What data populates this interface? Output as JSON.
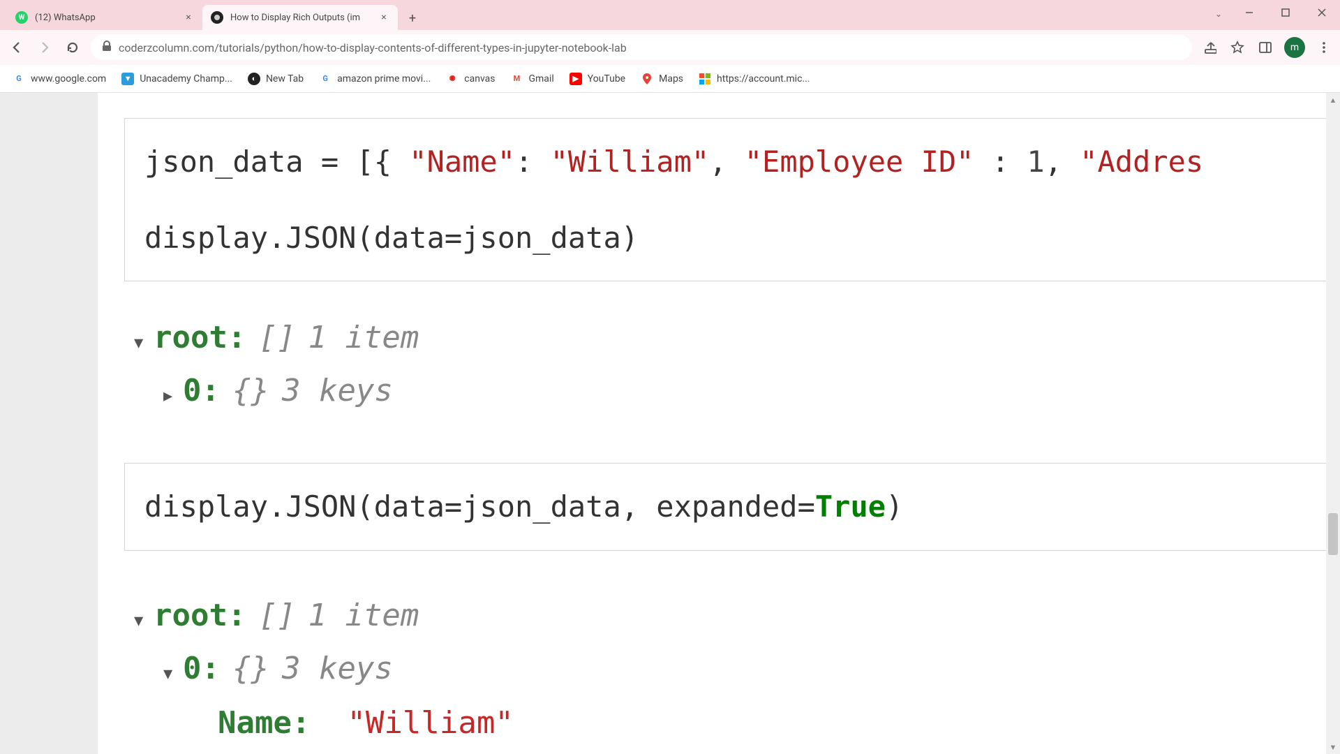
{
  "tabs": [
    {
      "title": "(12) WhatsApp"
    },
    {
      "title": "How to Display Rich Outputs (im"
    }
  ],
  "url": "coderzcolumn.com/tutorials/python/how-to-display-contents-of-different-types-in-jupyter-notebook-lab",
  "profile_letter": "m",
  "bookmarks": [
    {
      "label": "www.google.com"
    },
    {
      "label": "Unacademy Champ..."
    },
    {
      "label": "New Tab"
    },
    {
      "label": "amazon prime movi..."
    },
    {
      "label": "canvas"
    },
    {
      "label": "Gmail"
    },
    {
      "label": "YouTube"
    },
    {
      "label": "Maps"
    },
    {
      "label": "https://account.mic..."
    }
  ],
  "code1": {
    "var": "json_data",
    "key_name": "\"Name\"",
    "val_name": "\"William\"",
    "key_emp": "\"Employee ID\"",
    "val_emp": "1",
    "key_addr_partial": "\"Addres",
    "line2": "display.JSON(data=json_data)"
  },
  "output1": {
    "root_label": "root:",
    "root_brackets": "[]",
    "root_meta": "1 item",
    "child_label": "0:",
    "child_brackets": "{}",
    "child_meta": "3 keys"
  },
  "code2": {
    "prefix": "display.JSON(data=json_data, expanded=",
    "kw": "True",
    "suffix": ")"
  },
  "output2": {
    "root_label": "root:",
    "root_brackets": "[]",
    "root_meta": "1 item",
    "child_label": "0:",
    "child_brackets": "{}",
    "child_meta": "3 keys",
    "name_key": "Name:",
    "name_val": "\"William\""
  }
}
